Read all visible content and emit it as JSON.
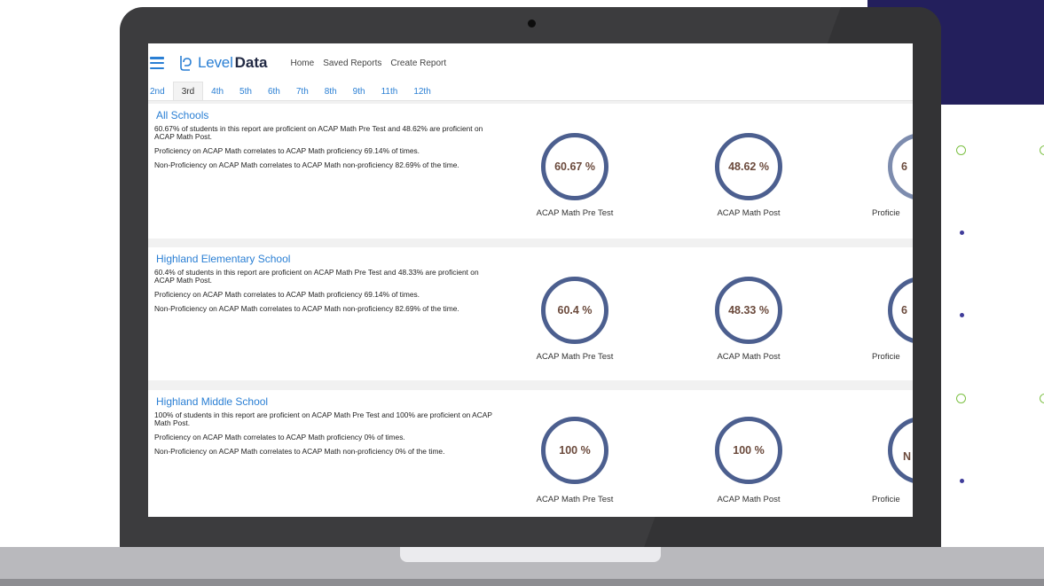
{
  "app": {
    "logo_light": "Level",
    "logo_bold": "Data",
    "nav": [
      "Home",
      "Saved Reports",
      "Create Report"
    ]
  },
  "tabs": [
    "2nd",
    "3rd",
    "4th",
    "5th",
    "6th",
    "7th",
    "8th",
    "9th",
    "11th",
    "12th"
  ],
  "active_tab": "3rd",
  "schools": [
    {
      "name": "All Schools",
      "summary": "60.67% of students in this report are proficient on ACAP Math Pre Test and 48.62% are proficient on ACAP Math Post.",
      "proficiency": "Proficiency on ACAP Math correlates to ACAP Math proficiency 69.14% of times.",
      "non_proficiency": "Non-Proficiency on ACAP Math correlates to ACAP Math non-proficiency 82.69% of the time.",
      "gauges": [
        {
          "value": "60.67 %",
          "label": "ACAP Math Pre Test"
        },
        {
          "value": "48.62 %",
          "label": "ACAP Math Post"
        },
        {
          "value": "6",
          "label": "Proficie"
        }
      ]
    },
    {
      "name": "Highland Elementary School",
      "summary": "60.4% of students in this report are proficient on ACAP Math Pre Test and 48.33% are proficient on ACAP Math Post.",
      "proficiency": "Proficiency on ACAP Math correlates to ACAP Math proficiency 69.14% of times.",
      "non_proficiency": "Non-Proficiency on ACAP Math correlates to ACAP Math non-proficiency 82.69% of the time.",
      "gauges": [
        {
          "value": "60.4 %",
          "label": "ACAP Math Pre Test"
        },
        {
          "value": "48.33 %",
          "label": "ACAP Math Post"
        },
        {
          "value": "6",
          "label": "Proficie"
        }
      ]
    },
    {
      "name": "Highland Middle School",
      "summary": "100% of students in this report are proficient on ACAP Math Pre Test and 100% are proficient on ACAP Math Post.",
      "proficiency": "Proficiency on ACAP Math correlates to ACAP Math proficiency 0% of times.",
      "non_proficiency": "Non-Proficiency on ACAP Math correlates to ACAP Math non-proficiency 0% of the time.",
      "gauges": [
        {
          "value": "100 %",
          "label": "ACAP Math Pre Test"
        },
        {
          "value": "100 %",
          "label": "ACAP Math Post"
        },
        {
          "value": "N",
          "label": "Proficie"
        }
      ]
    }
  ],
  "colors": {
    "brand_blue": "#2a7fd4",
    "gauge_ring": "#4c5f8f",
    "deco_panel": "#231f5c",
    "deco_ring": "#7cc043"
  }
}
